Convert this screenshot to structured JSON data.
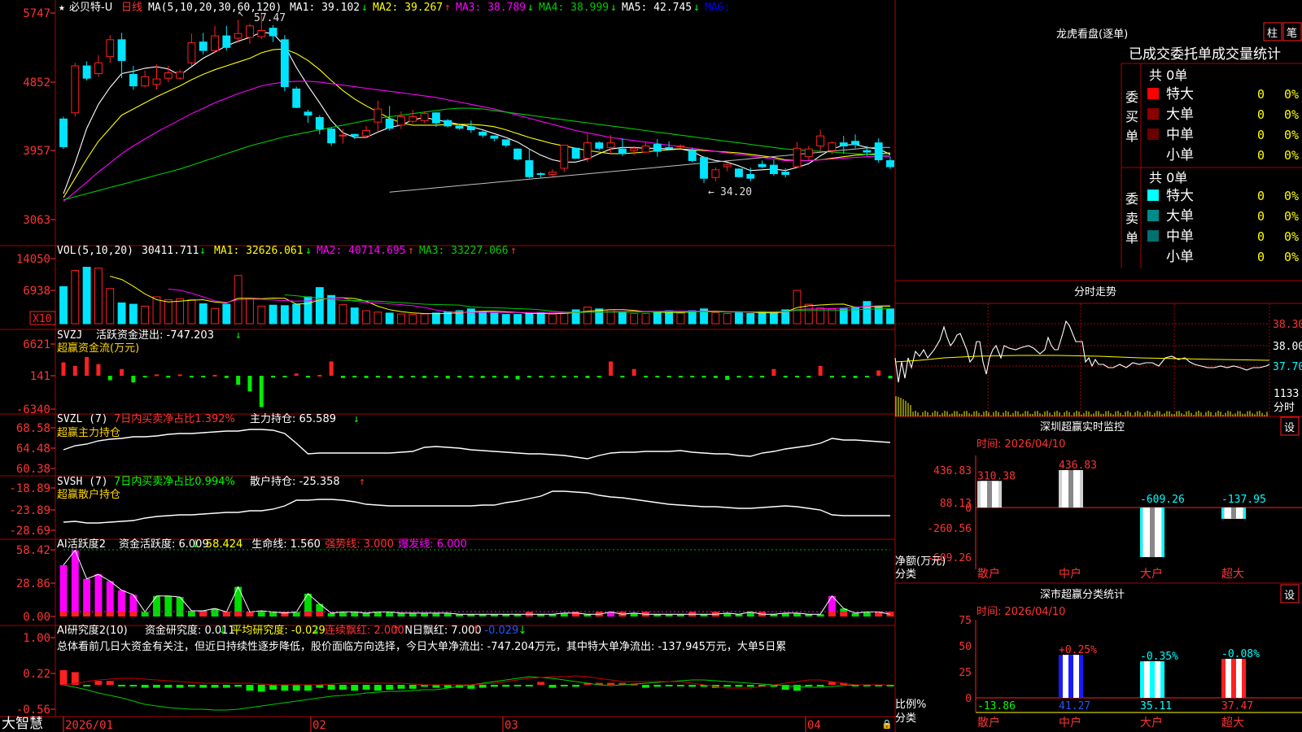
{
  "colors": {
    "up": "#ff2020",
    "down": "#00e5ff",
    "grid": "#b00000",
    "ma1": "#ffffff",
    "ma2": "#ffff00",
    "ma3": "#ff00ff",
    "ma4": "#00cc00",
    "ma5": "#c0c0c0",
    "green": "#00ff00"
  },
  "stock": {
    "name": "必贝特-U",
    "period": "日线",
    "brand": "大智慧"
  },
  "main": {
    "ma_params": "MA(5,10,20,30,60,120)",
    "ma_legend": [
      {
        "label": "MA1: 39.102",
        "arrow": "↓",
        "color": "#ffffff"
      },
      {
        "label": "MA2: 39.267",
        "arrow": "↑",
        "color": "#ffff00"
      },
      {
        "label": "MA3: 38.789",
        "arrow": "↓",
        "color": "#ff00ff"
      },
      {
        "label": "MA4: 38.999",
        "arrow": "↓",
        "color": "#00cc00"
      },
      {
        "label": "MA5: 42.745",
        "arrow": "↓",
        "color": "#ffffff"
      },
      {
        "label": "MA6:",
        "arrow": "",
        "color": "#0000ff"
      }
    ],
    "yticks": [
      "5747",
      "4852",
      "3957",
      "3063"
    ],
    "high_label": "57.47",
    "low_label": "34.20"
  },
  "vol": {
    "title": "VOL(5,10,20)",
    "value": "30411.711",
    "value_arrow": "↓",
    "ma_legend": [
      {
        "label": "MA1: 32626.061",
        "arrow": "↓",
        "color": "#ffff00"
      },
      {
        "label": "MA2: 40714.695",
        "arrow": "↑",
        "color": "#ff00ff"
      },
      {
        "label": "MA3: 33227.066",
        "arrow": "↑",
        "color": "#00cc00"
      }
    ],
    "yticks": [
      "14050",
      "6938"
    ],
    "unit": "X10"
  },
  "svzj": {
    "title": "SVZJ",
    "label": "活跃资金进出: -747.203",
    "arrow": "↓",
    "subtitle": "超赢资金流(万元)",
    "yticks": [
      "6621",
      "141",
      "-6340"
    ]
  },
  "svzl": {
    "title": "SVZL (7)",
    "label1": "7日内买卖净占比1.392%",
    "label2": "主力持仓: 65.589",
    "arrow": "↓",
    "subtitle": "超赢主力持仓",
    "yticks": [
      "68.58",
      "64.48",
      "60.38"
    ]
  },
  "svsh": {
    "title": "SVSH (7)",
    "label1": "7日内买卖净占比0.994%",
    "label2": "散户持仓: -25.358",
    "arrow": "↑",
    "subtitle": "超赢散户持仓",
    "yticks": [
      "-18.89",
      "-23.89",
      "-28.69"
    ]
  },
  "ai1": {
    "title": "AI活跃度2",
    "items": [
      {
        "text": "资金活跃度: 6.009",
        "arrow": "↓",
        "color": "#ffffff"
      },
      {
        "text": "58.424",
        "arrow": "",
        "color": "#ffff00"
      },
      {
        "text": "生命线: 1.560",
        "arrow": "",
        "color": "#ffffff"
      },
      {
        "text": "强势线: 3.000",
        "arrow": "",
        "color": "#ff3333"
      },
      {
        "text": "爆发线: 6.000",
        "arrow": "",
        "color": "#ff00ff"
      }
    ],
    "yticks": [
      "58.42",
      "28.86",
      "0.00"
    ]
  },
  "ai2": {
    "title": "AI研究度2(10)",
    "items": [
      {
        "text": "资金研究度: 0.011",
        "arrow": "↓",
        "color": "#ffffff"
      },
      {
        "text": "平均研究度: -0.029",
        "arrow": "↓",
        "color": "#ffff00"
      },
      {
        "text": "连续飘红: 2.000",
        "arrow": "↑",
        "color": "#ff3333"
      },
      {
        "text": "N日飘红: 7.000",
        "arrow": "↑",
        "color": "#ffffff"
      },
      {
        "text": "-0.029",
        "arrow": "↓",
        "color": "#2255ff"
      }
    ],
    "yticks": [
      "1.00",
      "0.22",
      "-0.56"
    ]
  },
  "comment": "总体看前几日大资金有关注，但近日持续性逐步降低，股价面临方向选择，今日大单净流出: -747.204万元，其中特大单净流出: -137.945万元，大单5日累",
  "dates": [
    "2026/01",
    "02",
    "03",
    "04"
  ],
  "lhb": {
    "title": "龙虎看盘(逐单)",
    "btn1": "柱",
    "btn2": "笔",
    "subtitle": "已成交委托单成交量统计",
    "buy_label": "委买单",
    "sell_label": "委卖单",
    "buy_total": "共 0单",
    "sell_total": "共 0单",
    "buy_rows": [
      {
        "name": "特大",
        "count": "0",
        "pct": "0%",
        "color": "#ff0000"
      },
      {
        "name": "大单",
        "count": "0",
        "pct": "0%",
        "color": "#8b0000"
      },
      {
        "name": "中单",
        "count": "0",
        "pct": "0%",
        "color": "#6b0000"
      },
      {
        "name": "小单",
        "count": "0",
        "pct": "0%",
        "color": ""
      }
    ],
    "sell_rows": [
      {
        "name": "特大",
        "count": "0",
        "pct": "0%",
        "color": "#00ffff"
      },
      {
        "name": "大单",
        "count": "0",
        "pct": "0%",
        "color": "#008b8b"
      },
      {
        "name": "中单",
        "count": "0",
        "pct": "0%",
        "color": "#007070"
      },
      {
        "name": "小单",
        "count": "0",
        "pct": "0%",
        "color": ""
      }
    ]
  },
  "fenshi": {
    "title": "分时走势",
    "yticks": [
      "38.30",
      "38.00",
      "37.70"
    ],
    "vol_label": "1133",
    "vol_caption": "分时"
  },
  "sz_monitor": {
    "title": "深圳超赢实时监控",
    "btn": "设",
    "time": "时间: 2026/04/10",
    "yticks": [
      "436.83",
      "88.13",
      "0",
      "-260.56",
      "-609.26"
    ],
    "ylabel1": "净额(万元)",
    "ylabel2": "分类",
    "categories": [
      "散户",
      "中户",
      "大户",
      "超大"
    ],
    "values": [
      310.38,
      436.83,
      -609.26,
      -137.95
    ],
    "value_labels": [
      "310.38",
      "436.83",
      "-609.26",
      "-137.95"
    ]
  },
  "sz_class": {
    "title": "深市超赢分类统计",
    "btn": "设",
    "time": "时间: 2026/04/10",
    "yticks": [
      "75",
      "50",
      "25",
      "0"
    ],
    "ylabel1": "比例%",
    "ylabel2": "分类",
    "categories": [
      "散户",
      "中户",
      "大户",
      "超大"
    ],
    "values": [
      13.86,
      41.27,
      35.11,
      37.47
    ],
    "value_labels": [
      "-13.86",
      "41.27",
      "35.11",
      "37.47"
    ],
    "change_labels": [
      "",
      "+0.25%",
      "-0.35%",
      "-0.08%"
    ],
    "bar_colors": [
      "",
      "#1a1aff",
      "#00ffff",
      "#ff2020"
    ]
  },
  "chart_data": {
    "type": "candlestick",
    "ylim": [
      30.63,
      57.47
    ],
    "high": 57.47,
    "low": 34.2,
    "candles": [
      [
        43.7,
        40.1,
        44.0,
        39.8
      ],
      [
        44.5,
        50.6,
        51.0,
        44.0
      ],
      [
        50.6,
        49.0,
        51.2,
        48.7
      ],
      [
        49.6,
        51.0,
        52.0,
        49.2
      ],
      [
        51.8,
        54.0,
        54.6,
        51.0
      ],
      [
        54.0,
        51.3,
        54.9,
        49.0
      ],
      [
        49.5,
        48.0,
        50.6,
        47.5
      ],
      [
        48.0,
        49.2,
        50.0,
        47.8
      ],
      [
        48.2,
        48.9,
        50.8,
        47.5
      ],
      [
        49.0,
        49.7,
        50.6,
        48.5
      ],
      [
        49.0,
        49.8,
        50.1,
        48.8
      ],
      [
        51.0,
        53.6,
        54.8,
        50.6
      ],
      [
        53.7,
        52.6,
        54.9,
        52.1
      ],
      [
        52.6,
        54.5,
        55.8,
        52.2
      ],
      [
        54.5,
        53.0,
        55.8,
        52.6
      ],
      [
        54.2,
        54.8,
        56.6,
        53.6
      ],
      [
        54.3,
        55.8,
        56.1,
        53.5
      ],
      [
        54.4,
        55.2,
        57.5,
        54.1
      ],
      [
        55.5,
        54.5,
        55.9,
        53.7
      ],
      [
        54.0,
        47.9,
        54.6,
        47.3
      ],
      [
        47.6,
        45.2,
        47.9,
        45.1
      ],
      [
        44.6,
        44.2,
        44.9,
        43.2
      ],
      [
        43.9,
        42.4,
        44.2,
        41.7
      ],
      [
        42.4,
        40.6,
        42.6,
        40.2
      ],
      [
        41.5,
        41.6,
        42.4,
        40.5
      ],
      [
        41.7,
        41.5,
        41.8,
        41.1
      ],
      [
        41.5,
        42.2,
        42.8,
        41.3
      ],
      [
        43.3,
        45.0,
        46.1,
        42.0
      ],
      [
        43.7,
        42.5,
        45.4,
        42.2
      ],
      [
        42.9,
        44.0,
        44.7,
        42.4
      ],
      [
        43.4,
        44.0,
        44.9,
        43.1
      ],
      [
        43.5,
        44.4,
        44.7,
        43.2
      ],
      [
        44.5,
        43.2,
        44.6,
        42.7
      ],
      [
        43.5,
        42.8,
        43.7,
        42.6
      ],
      [
        42.8,
        42.5,
        43.0,
        42.3
      ],
      [
        42.7,
        42.3,
        43.5,
        41.9
      ],
      [
        42.0,
        41.6,
        42.2,
        41.3
      ],
      [
        41.5,
        41.2,
        41.5,
        40.8
      ],
      [
        41.0,
        40.3,
        41.0,
        40.0
      ],
      [
        39.8,
        38.5,
        39.9,
        38.3
      ],
      [
        38.3,
        36.2,
        39.8,
        36.0
      ],
      [
        36.6,
        36.5,
        36.8,
        36.1
      ],
      [
        36.5,
        36.8,
        37.2,
        36.2
      ],
      [
        37.3,
        40.3,
        40.3,
        36.8
      ],
      [
        39.9,
        38.6,
        40.0,
        38.5
      ],
      [
        38.6,
        40.6,
        41.8,
        38.1
      ],
      [
        40.6,
        39.9,
        40.8,
        39.6
      ],
      [
        40.0,
        40.6,
        41.6,
        39.2
      ],
      [
        39.8,
        39.2,
        41.2,
        38.9
      ],
      [
        39.6,
        39.9,
        40.2,
        39.0
      ],
      [
        39.4,
        40.2,
        40.6,
        39.3
      ],
      [
        40.4,
        39.5,
        41.1,
        38.8
      ],
      [
        40.0,
        39.9,
        40.8,
        39.6
      ],
      [
        40.1,
        40.2,
        40.4,
        39.9
      ],
      [
        39.6,
        38.3,
        40.0,
        38.1
      ],
      [
        38.7,
        36.0,
        38.9,
        35.4
      ],
      [
        36.1,
        37.1,
        37.4,
        35.6
      ],
      [
        37.5,
        37.8,
        38.0,
        36.9
      ],
      [
        37.2,
        36.2,
        37.3,
        36.1
      ],
      [
        36.5,
        36.0,
        37.4,
        35.6
      ],
      [
        37.8,
        37.5,
        38.3,
        37.3
      ],
      [
        37.7,
        36.6,
        38.4,
        36.3
      ],
      [
        36.8,
        36.5,
        37.3,
        36.1
      ],
      [
        37.5,
        39.9,
        40.7,
        37.3
      ],
      [
        38.8,
        39.8,
        40.2,
        38.4
      ],
      [
        40.2,
        41.5,
        42.3,
        39.6
      ],
      [
        39.6,
        40.6,
        40.8,
        39.1
      ],
      [
        40.6,
        40.2,
        41.5,
        39.2
      ],
      [
        40.8,
        40.4,
        41.7,
        39.9
      ],
      [
        39.6,
        39.4,
        40.2,
        38.9
      ],
      [
        40.6,
        38.4,
        41.2,
        38.0
      ],
      [
        38.3,
        37.5,
        38.8,
        37.2
      ]
    ],
    "ma_series": [
      {
        "color": "#ffffff",
        "values": [
          34.0,
          38.0,
          42.5,
          45.6,
          47.8,
          49.6,
          49.9,
          50.3,
          50.5,
          50.2,
          49.4,
          50.5,
          51.6,
          52.4,
          53.2,
          53.8,
          54.3,
          55.0,
          54.8,
          53.2,
          50.4,
          48.0,
          45.8,
          43.5,
          41.9,
          41.3,
          41.3,
          42.0,
          42.6,
          42.9,
          43.6,
          43.9,
          43.6,
          43.3,
          43.0,
          42.7,
          42.3,
          41.8,
          41.3,
          40.7,
          39.8,
          39.0,
          38.4,
          38.1,
          38.1,
          38.5,
          39.2,
          39.8,
          40.0,
          40.0,
          39.9,
          39.9,
          39.8,
          39.8,
          39.5,
          38.7,
          38.3,
          38.1,
          37.6,
          37.0,
          37.1,
          37.2,
          37.0,
          37.4,
          37.9,
          38.9,
          39.8,
          40.3,
          40.4,
          40.0,
          39.8,
          39.1
        ]
      },
      {
        "color": "#ffff00",
        "values": [
          33.5,
          36.0,
          38.5,
          40.8,
          42.5,
          44.2,
          45.0,
          45.8,
          46.6,
          47.3,
          48.0,
          48.8,
          49.5,
          50.1,
          50.6,
          51.1,
          51.6,
          52.3,
          52.7,
          52.8,
          52.2,
          51.3,
          50.1,
          48.7,
          47.4,
          46.3,
          45.4,
          44.6,
          43.8,
          43.2,
          42.9,
          42.9,
          42.9,
          43.0,
          43.0,
          43.0,
          42.9,
          42.7,
          42.3,
          41.8,
          41.3,
          40.9,
          40.5,
          40.2,
          39.9,
          39.6,
          39.4,
          39.2,
          39.2,
          39.3,
          39.4,
          39.6,
          39.7,
          39.8,
          39.7,
          39.6,
          39.5,
          39.4,
          39.3,
          39.1,
          38.9,
          38.7,
          38.4,
          38.3,
          38.3,
          38.4,
          38.6,
          38.8,
          39.0,
          39.1,
          39.2,
          39.3
        ]
      },
      {
        "color": "#ff00ff",
        "values": [
          33.0,
          34.2,
          35.5,
          36.8,
          38.0,
          39.2,
          40.2,
          41.1,
          42.0,
          42.8,
          43.6,
          44.4,
          45.1,
          45.8,
          46.4,
          47.0,
          47.5,
          48.0,
          48.3,
          48.5,
          48.6,
          48.6,
          48.5,
          48.3,
          48.1,
          47.9,
          47.7,
          47.5,
          47.3,
          47.1,
          46.9,
          46.7,
          46.5,
          46.2,
          45.9,
          45.6,
          45.3,
          45.0,
          44.6,
          44.2,
          43.8,
          43.4,
          43.0,
          42.6,
          42.2,
          41.9,
          41.6,
          41.3,
          41.1,
          40.9,
          40.7,
          40.5,
          40.3,
          40.1,
          39.9,
          39.7,
          39.5,
          39.3,
          39.1,
          38.9,
          38.7,
          38.5,
          38.3,
          38.3,
          38.3,
          38.4,
          38.5,
          38.6,
          38.7,
          38.8,
          38.8,
          38.8
        ]
      },
      {
        "color": "#00cc00",
        "values": [
          33.2,
          33.6,
          34.0,
          34.4,
          34.8,
          35.2,
          35.6,
          36.0,
          36.4,
          36.8,
          37.2,
          37.7,
          38.2,
          38.7,
          39.2,
          39.7,
          40.2,
          40.6,
          41.0,
          41.4,
          41.7,
          42.0,
          42.3,
          42.6,
          42.9,
          43.2,
          43.5,
          43.8,
          44.0,
          44.2,
          44.4,
          44.6,
          44.8,
          45.0,
          45.1,
          45.1,
          45.0,
          44.8,
          44.6,
          44.4,
          44.2,
          44.0,
          43.8,
          43.6,
          43.4,
          43.2,
          43.0,
          42.8,
          42.6,
          42.4,
          42.2,
          42.0,
          41.8,
          41.6,
          41.4,
          41.2,
          41.0,
          40.8,
          40.6,
          40.4,
          40.2,
          40.0,
          39.8,
          39.7,
          39.6,
          39.5,
          39.4,
          39.3,
          39.2,
          39.1,
          39.0,
          39.0
        ]
      },
      {
        "color": "#c0c0c0",
        "values": [
          null,
          null,
          null,
          null,
          null,
          null,
          null,
          null,
          null,
          null,
          null,
          null,
          null,
          null,
          null,
          null,
          null,
          null,
          null,
          null,
          null,
          null,
          null,
          null,
          null,
          null,
          null,
          null,
          null,
          null,
          null,
          null,
          null,
          null,
          null,
          null,
          null,
          null,
          null,
          null,
          null,
          null,
          null,
          null,
          null,
          null,
          null,
          null,
          null,
          null,
          null,
          null,
          null,
          null,
          null,
          null,
          null,
          null,
          null,
          null,
          null,
          null,
          null,
          null,
          null,
          null,
          null,
          null,
          null,
          null,
          null,
          null
        ]
      }
    ],
    "volume": [
      8,
      11.5,
      12.2,
      12,
      7.6,
      4.5,
      4.2,
      3.8,
      5.8,
      5.2,
      5.4,
      5.2,
      4.3,
      3.3,
      4.2,
      10.4,
      5.3,
      3.8,
      4,
      3.9,
      4.2,
      5.8,
      7.8,
      6.1,
      4.1,
      3.4,
      2.8,
      2.5,
      2.3,
      2.1,
      2,
      2.1,
      2.3,
      2.6,
      2.8,
      3.2,
      2.6,
      2.4,
      2,
      2,
      2.2,
      2.4,
      2.1,
      2.4,
      3,
      3.6,
      3.2,
      3,
      2.4,
      2.2,
      2.2,
      2.6,
      2.8,
      2.3,
      2.8,
      3.2,
      2.4,
      2.2,
      2.4,
      2.2,
      2.6,
      2.4,
      3,
      7.2,
      4.2,
      3.4,
      3.2,
      3.2,
      3.6,
      4.8,
      3.8,
      3.2
    ],
    "vol_ylim": [
      0,
      14.05
    ]
  }
}
